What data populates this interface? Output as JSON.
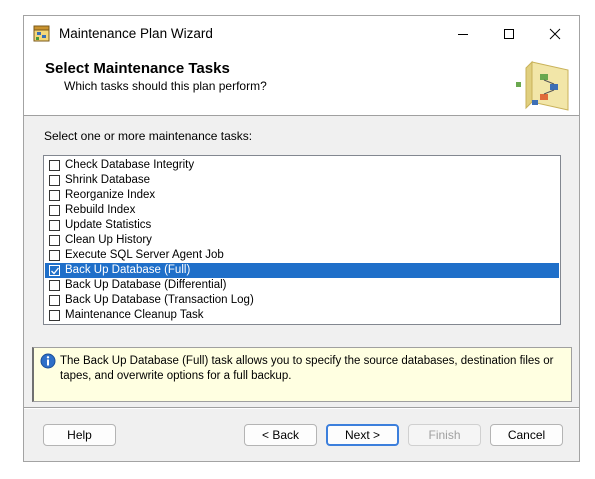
{
  "window": {
    "title": "Maintenance Plan Wizard",
    "controls": {
      "minimize": "—",
      "maximize": "☐",
      "close": "✕"
    }
  },
  "header": {
    "title": "Select Maintenance Tasks",
    "subtitle": "Which tasks should this plan perform?",
    "graphic_icon": "wizard-flowchart-icon"
  },
  "prompt": "Select one or more maintenance tasks:",
  "tasks": [
    {
      "label": "Check Database Integrity",
      "checked": false,
      "selected": false
    },
    {
      "label": "Shrink Database",
      "checked": false,
      "selected": false
    },
    {
      "label": "Reorganize Index",
      "checked": false,
      "selected": false
    },
    {
      "label": "Rebuild Index",
      "checked": false,
      "selected": false
    },
    {
      "label": "Update Statistics",
      "checked": false,
      "selected": false
    },
    {
      "label": "Clean Up History",
      "checked": false,
      "selected": false
    },
    {
      "label": "Execute SQL Server Agent Job",
      "checked": false,
      "selected": false
    },
    {
      "label": "Back Up Database (Full)",
      "checked": true,
      "selected": true
    },
    {
      "label": "Back Up Database (Differential)",
      "checked": false,
      "selected": false
    },
    {
      "label": "Back Up Database (Transaction Log)",
      "checked": false,
      "selected": false
    },
    {
      "label": "Maintenance Cleanup Task",
      "checked": false,
      "selected": false
    }
  ],
  "info": {
    "icon": "info-icon",
    "text": "The Back Up Database (Full) task allows you to specify the source databases, destination files or tapes, and overwrite options for a full backup."
  },
  "buttons": {
    "help": "Help",
    "back": "< Back",
    "next": "Next >",
    "finish": "Finish",
    "cancel": "Cancel"
  },
  "colors": {
    "selection": "#1f6fc9",
    "info_background": "#ffffe1",
    "dialog_background": "#f0f0f0",
    "default_button_border": "#3c7fdc"
  }
}
